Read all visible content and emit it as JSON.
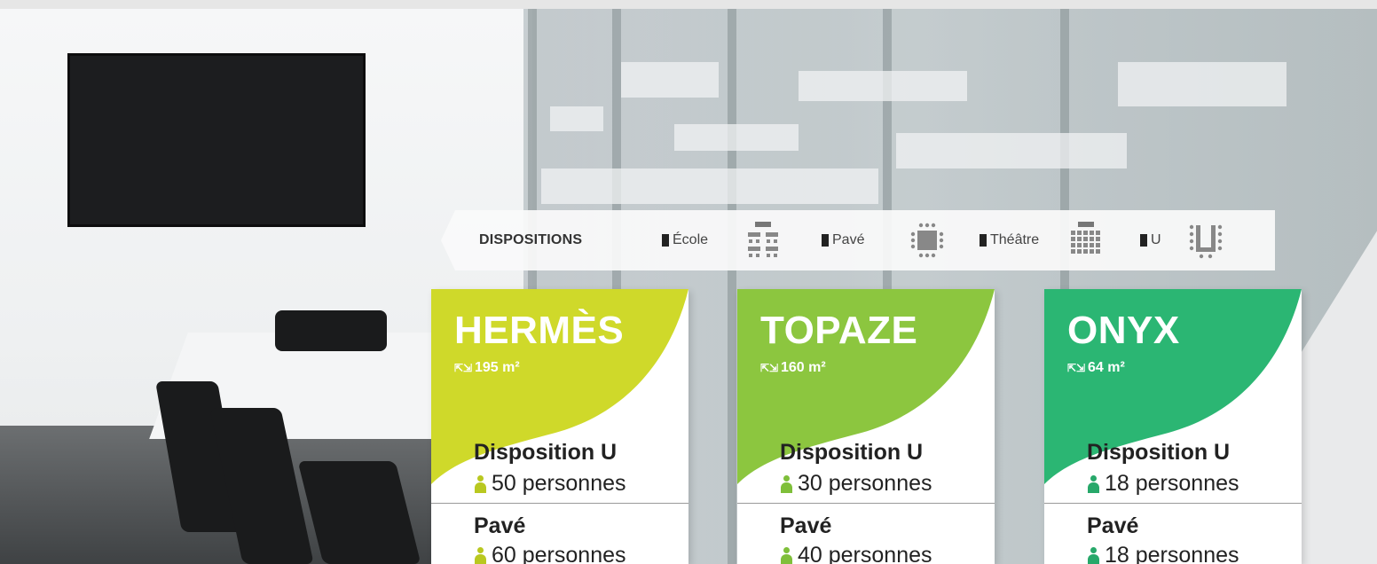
{
  "dispositions": {
    "title": "DISPOSITIONS",
    "items": [
      {
        "label": "École",
        "icon": "ecole-layout-icon"
      },
      {
        "label": "Pavé",
        "icon": "pave-layout-icon"
      },
      {
        "label": "Théâtre",
        "icon": "theatre-layout-icon"
      },
      {
        "label": "U",
        "icon": "u-layout-icon"
      }
    ]
  },
  "rooms": [
    {
      "name": "HERMÈS",
      "area": "195 m²",
      "color": "#cfd92a",
      "disposition_u_label": "Disposition U",
      "disposition_u_count": "50 personnes",
      "pave_label": "Pavé",
      "pave_count": "60 personnes",
      "person_color": "#b9c820"
    },
    {
      "name": "TOPAZE",
      "area": "160 m²",
      "color": "#8cc63f",
      "disposition_u_label": "Disposition U",
      "disposition_u_count": "30 personnes",
      "pave_label": "Pavé",
      "pave_count": "40 personnes",
      "person_color": "#7fbf3a"
    },
    {
      "name": "ONYX",
      "area": "64 m²",
      "color": "#2bb673",
      "disposition_u_label": "Disposition U",
      "disposition_u_count": "18 personnes",
      "pave_label": "Pavé",
      "pave_count": "18 personnes",
      "person_color": "#27a86a"
    }
  ]
}
